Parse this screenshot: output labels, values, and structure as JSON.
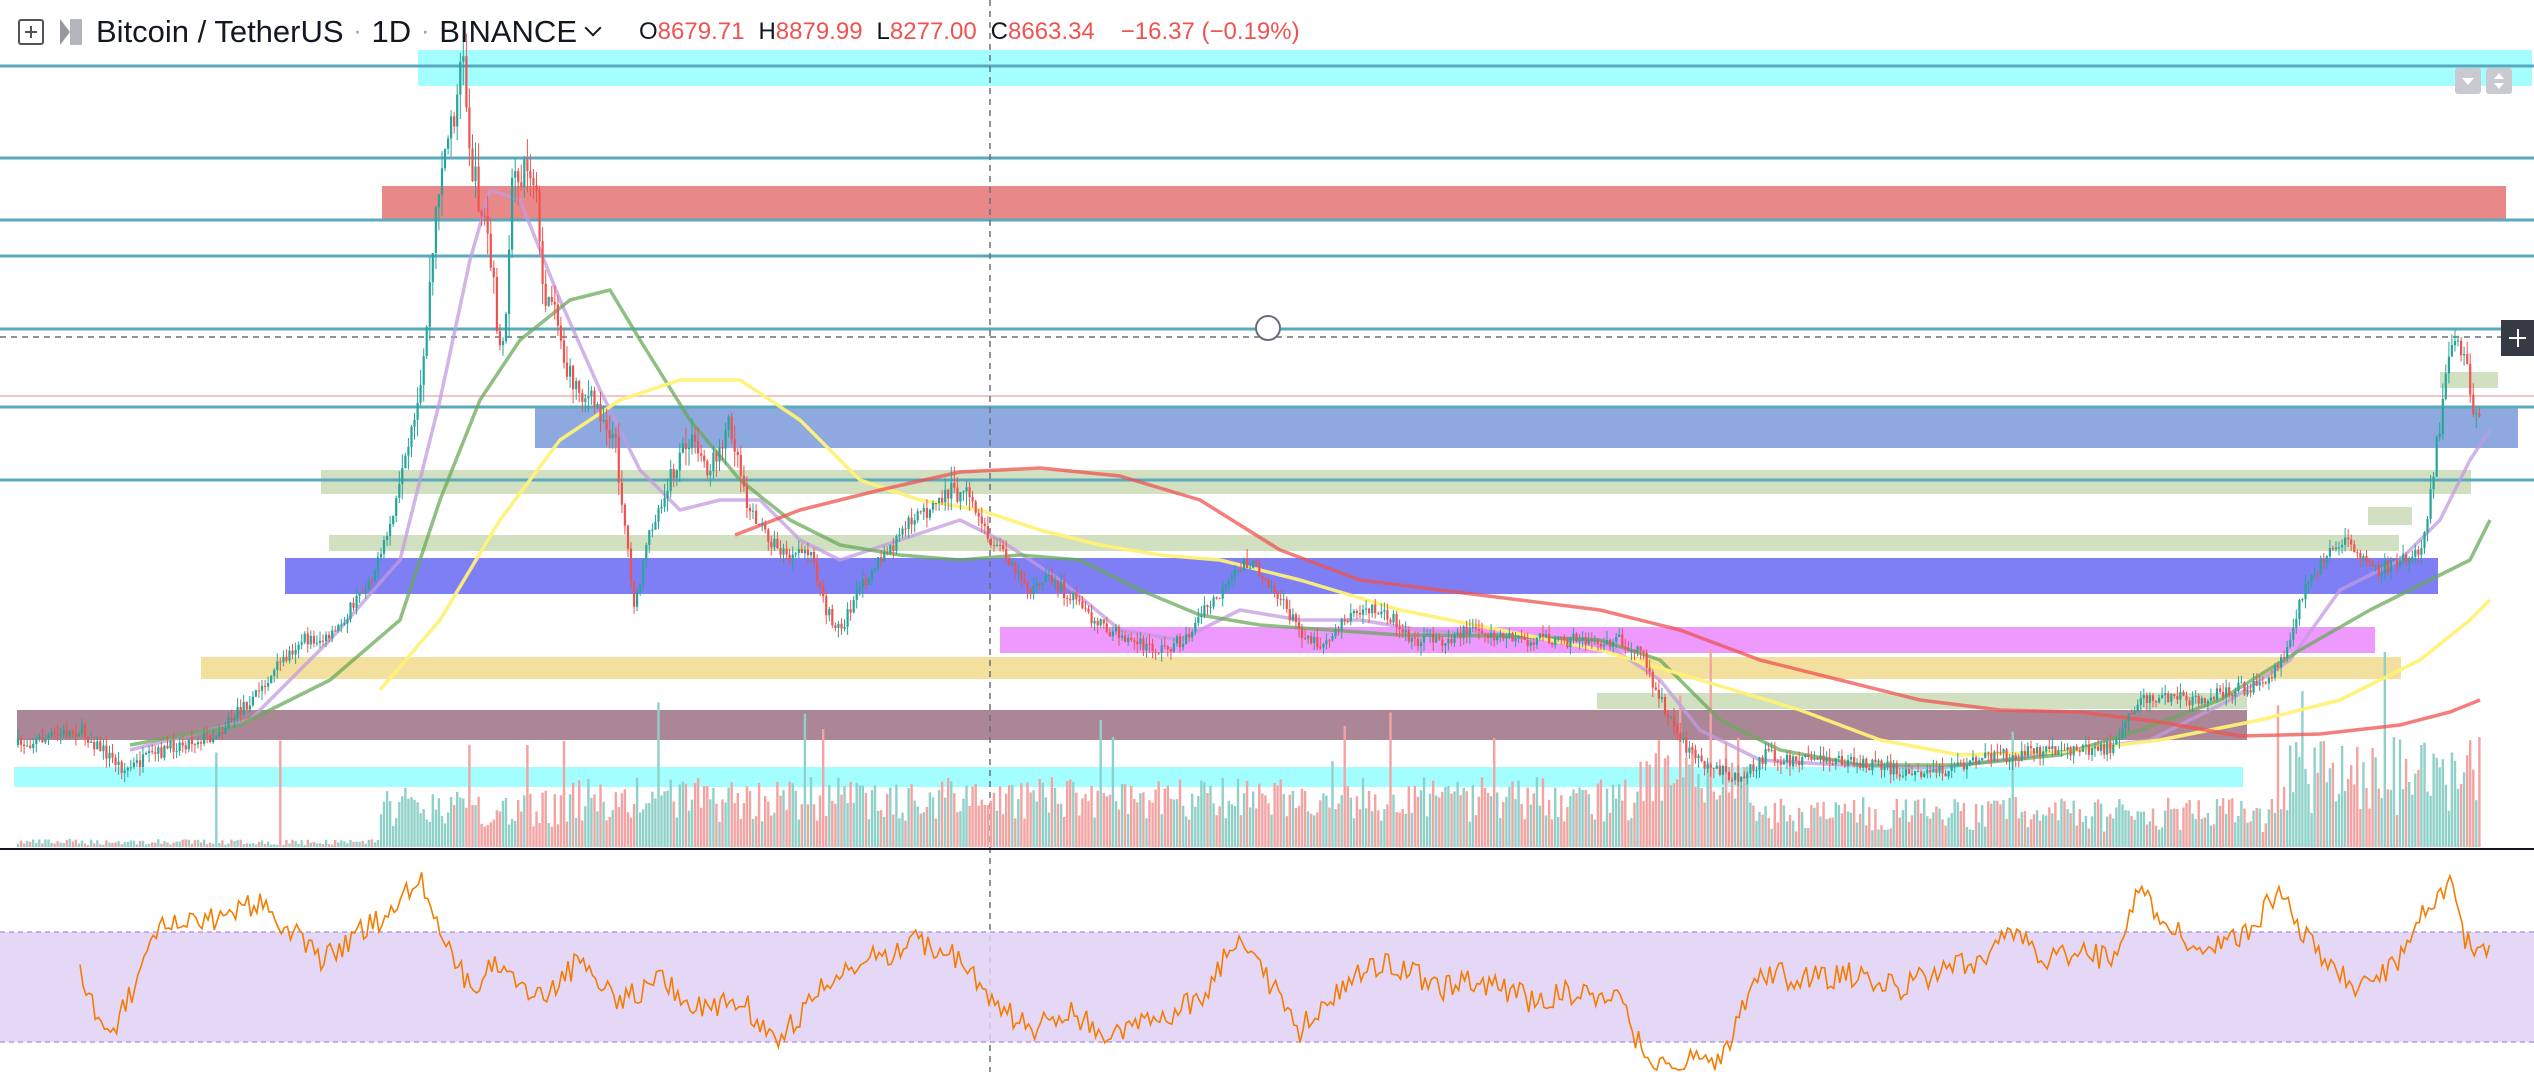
{
  "legend": {
    "add_symbol_icon": "plus-square-icon",
    "symbol": "Bitcoin / TetherUS",
    "interval": "1D",
    "exchange": "BINANCE",
    "open_key": "O",
    "open": "8679.71",
    "high_key": "H",
    "high": "8879.99",
    "low_key": "L",
    "low": "8277.00",
    "close_key": "C",
    "close": "8663.34",
    "change": "−16.37 (−0.19%)"
  },
  "colors": {
    "up_candle": "#26a69a",
    "down_candle": "#ef5350",
    "value_text": "#ef5350",
    "rsi_line": "#f57c00",
    "rsi_band": "#e1d1f5",
    "ma_colors": [
      "#c39be0",
      "#6aaa5a",
      "#fff176",
      "#ef5350"
    ]
  },
  "controls": {
    "collapse_icon": "triangle-down-icon",
    "maximize_icon": "arrows-vertical-icon",
    "crosshair_plus_icon": "plus-icon"
  },
  "chart_data": [
    {
      "type": "candlestick",
      "title": "",
      "series": [
        {
          "name": "",
          "kind": "volume"
        },
        {
          "name": "",
          "kind": "moving-average"
        }
      ],
      "last": {
        "open": 8679.71,
        "high": 8879.99,
        "low": 8277.0,
        "close": 8663.34,
        "change": -16.37,
        "change_pct": -0.19
      },
      "grid": false
    },
    {
      "type": "line",
      "series": [
        {
          "name": "",
          "kind": "rsi"
        }
      ],
      "grid": false
    }
  ]
}
